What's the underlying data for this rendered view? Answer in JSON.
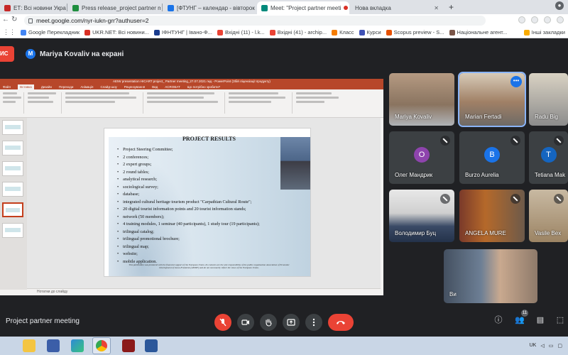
{
  "browser": {
    "tabs": [
      {
        "label": "ЕТ: Всі новини України, с",
        "favicon_color": "#c62828",
        "active": false
      },
      {
        "label": "Press release_project partner me",
        "favicon_color": "#1e8e3e",
        "active": false
      },
      {
        "label": "[ФТУНГ – календар - вівторок",
        "favicon_color": "#1a73e8",
        "active": false
      },
      {
        "label": "Meet: \"Project partner meeti",
        "favicon_color": "#00897b",
        "active": true
      },
      {
        "label": "Нова вкладка",
        "favicon_color": "#9aa0a6",
        "active": false
      }
    ],
    "url": "meet.google.com/nyr-iukn-grr?authuser=2",
    "bookmarks": [
      {
        "label": "Google Перекладник",
        "color": "#4285f4"
      },
      {
        "label": "UKR.NET: Всі новини...",
        "color": "#d93025"
      },
      {
        "label": "ІФНТУНГ | Івано-Ф...",
        "color": "#1a3c8e"
      },
      {
        "label": "Вхідні (11) - l.k...",
        "color": "#ea4335"
      },
      {
        "label": "Вхідні (41) - archip...",
        "color": "#ea4335"
      },
      {
        "label": "Класс",
        "color": "#f57c00"
      },
      {
        "label": "Курси",
        "color": "#3f51b5"
      },
      {
        "label": "Scopus preview - S...",
        "color": "#e65100"
      },
      {
        "label": "Національне агент...",
        "color": "#795548"
      }
    ],
    "other_bookmarks": "Інші закладки"
  },
  "meet": {
    "presenting_badge": "ИС",
    "presenter_initial": "M",
    "presenter_text": "Mariya Kovaliv на екрані",
    "meeting_title": "Project partner meeting",
    "participant_count": "11",
    "participants": [
      {
        "name": "Mariya Kovaliv",
        "type": "video",
        "muted": false
      },
      {
        "name": "Marian Fertadi",
        "type": "video",
        "muted": false,
        "speaking": true
      },
      {
        "name": "Radu Big",
        "type": "video",
        "muted": false
      },
      {
        "name": "Олег Мандрик",
        "type": "avatar",
        "initial": "O",
        "color": "#8e44ad",
        "muted": true
      },
      {
        "name": "Burzo Aurelia",
        "type": "avatar",
        "initial": "B",
        "color": "#1a73e8",
        "muted": true
      },
      {
        "name": "Tetiana Mak",
        "type": "avatar",
        "initial": "T",
        "color": "#1565c0",
        "muted": true
      },
      {
        "name": "Володимир Буц",
        "type": "video",
        "muted": true
      },
      {
        "name": "ANGELA MURE",
        "type": "video",
        "muted": true
      },
      {
        "name": "Vasile Bex",
        "type": "video",
        "muted": true
      },
      {
        "name": "Ви",
        "type": "video",
        "muted": false
      }
    ]
  },
  "powerpoint": {
    "window_title": "AEIW presentation HICART project_ Partner meeting_27.07.2021 пкд - PowerPoint (Збій ліцензіації продукту)",
    "ribbon_tabs": [
      "Файл",
      "Вставка",
      "Дизайн",
      "Переходи",
      "Анімація",
      "Слайд-шоу",
      "Рецензування",
      "Вид",
      "ACROBAT",
      "Що потрібно зробити?"
    ],
    "notes_placeholder": "Нотатки до слайду",
    "slide": {
      "title": "PROJECT RESULTS",
      "items": [
        "Project Steering Committee;",
        "2 conferences;",
        "2 expert groups;",
        "2 round tables;",
        "analytical research;",
        "sociological survey;",
        "database;",
        "integrated cultural heritage tourism product \"Carpathian Cultural Route\";",
        "20 digital tourist information points and 20 tourist information stands;",
        "network (50 members);",
        "4 training modules, 1 seminar (40 participants), 1 study tour (19 participants);",
        "trilingual catalog;",
        "trilingual promotional brochure;",
        "trilingual map;",
        "website;",
        "mobile application."
      ],
      "footer": "This publication was produced with the financial support of the European Union. Its contents are the sole responsibility of the public organization Association of Economic Development of Ivano-Frankivsk (AEDIF) and do not necessarily reflect the views of the European Union."
    }
  },
  "taskbar": {
    "language": "UK"
  }
}
